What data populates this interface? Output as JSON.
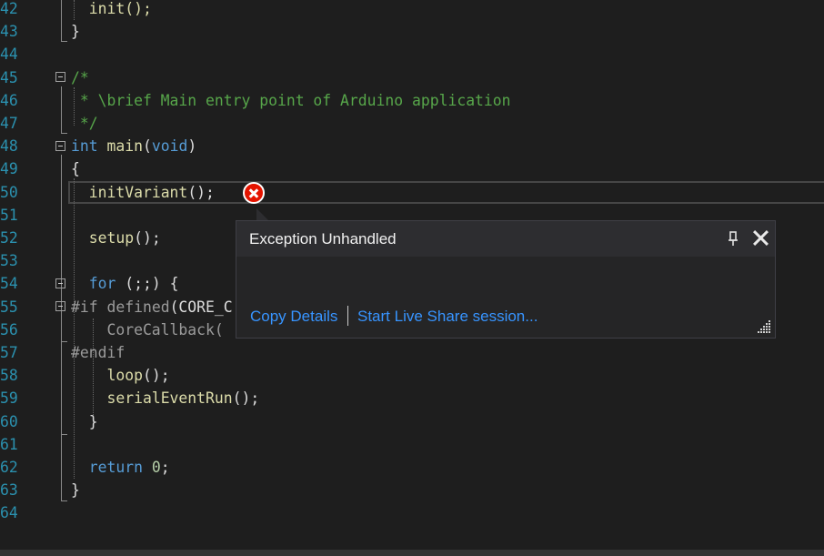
{
  "editor": {
    "lines": [
      {
        "n": "42",
        "tokens": [
          {
            "t": "  init();",
            "c": "fn"
          }
        ]
      },
      {
        "n": "43",
        "tokens": [
          {
            "t": "}",
            "c": "pl"
          }
        ]
      },
      {
        "n": "44",
        "tokens": []
      },
      {
        "n": "45",
        "tokens": [
          {
            "t": "/*",
            "c": "cm"
          }
        ]
      },
      {
        "n": "46",
        "tokens": [
          {
            "t": " * \\brief Main entry point of Arduino application",
            "c": "cm"
          }
        ]
      },
      {
        "n": "47",
        "tokens": [
          {
            "t": " */",
            "c": "cm"
          }
        ]
      },
      {
        "n": "48",
        "tokens": [
          {
            "t": "int",
            "c": "kw"
          },
          {
            "t": " ",
            "c": "pl"
          },
          {
            "t": "main",
            "c": "fn"
          },
          {
            "t": "(",
            "c": "pl"
          },
          {
            "t": "void",
            "c": "kw"
          },
          {
            "t": ")",
            "c": "pl"
          }
        ]
      },
      {
        "n": "49",
        "tokens": [
          {
            "t": "{",
            "c": "pl"
          }
        ]
      },
      {
        "n": "50",
        "tokens": [
          {
            "t": "  ",
            "c": "pl"
          },
          {
            "t": "initVariant",
            "c": "fn"
          },
          {
            "t": "();",
            "c": "pl"
          }
        ]
      },
      {
        "n": "51",
        "tokens": []
      },
      {
        "n": "52",
        "tokens": [
          {
            "t": "  ",
            "c": "pl"
          },
          {
            "t": "setup",
            "c": "fn"
          },
          {
            "t": "();",
            "c": "pl"
          }
        ]
      },
      {
        "n": "53",
        "tokens": []
      },
      {
        "n": "54",
        "tokens": [
          {
            "t": "  ",
            "c": "pl"
          },
          {
            "t": "for",
            "c": "kw"
          },
          {
            "t": " (;;) {",
            "c": "pl"
          }
        ]
      },
      {
        "n": "55",
        "tokens": [
          {
            "t": "#if",
            "c": "pp"
          },
          {
            "t": " ",
            "c": "pl"
          },
          {
            "t": "defined",
            "c": "pp"
          },
          {
            "t": "(CORE_C",
            "c": "pl"
          }
        ]
      },
      {
        "n": "56",
        "tokens": [
          {
            "t": "    CoreCallback(",
            "c": "pp"
          }
        ]
      },
      {
        "n": "57",
        "tokens": [
          {
            "t": "#endif",
            "c": "pp"
          }
        ]
      },
      {
        "n": "58",
        "tokens": [
          {
            "t": "    ",
            "c": "pl"
          },
          {
            "t": "loop",
            "c": "fn"
          },
          {
            "t": "();",
            "c": "pl"
          }
        ]
      },
      {
        "n": "59",
        "tokens": [
          {
            "t": "    ",
            "c": "pl"
          },
          {
            "t": "serialEventRun",
            "c": "fn"
          },
          {
            "t": "();",
            "c": "pl"
          }
        ]
      },
      {
        "n": "60",
        "tokens": [
          {
            "t": "  }",
            "c": "pl"
          }
        ]
      },
      {
        "n": "61",
        "tokens": []
      },
      {
        "n": "62",
        "tokens": [
          {
            "t": "  ",
            "c": "pl"
          },
          {
            "t": "return",
            "c": "kw"
          },
          {
            "t": " ",
            "c": "pl"
          },
          {
            "t": "0",
            "c": "num"
          },
          {
            "t": ";",
            "c": "pl"
          }
        ]
      },
      {
        "n": "63",
        "tokens": [
          {
            "t": "}",
            "c": "pl"
          }
        ]
      },
      {
        "n": "64",
        "tokens": []
      }
    ]
  },
  "error_icon": "error-circle-icon",
  "popup": {
    "title": "Exception Unhandled",
    "pin_icon": "pin-icon",
    "close_icon": "close-icon",
    "copy_details": "Copy Details",
    "live_share": "Start Live Share session...",
    "link_color": "#3794ff"
  }
}
